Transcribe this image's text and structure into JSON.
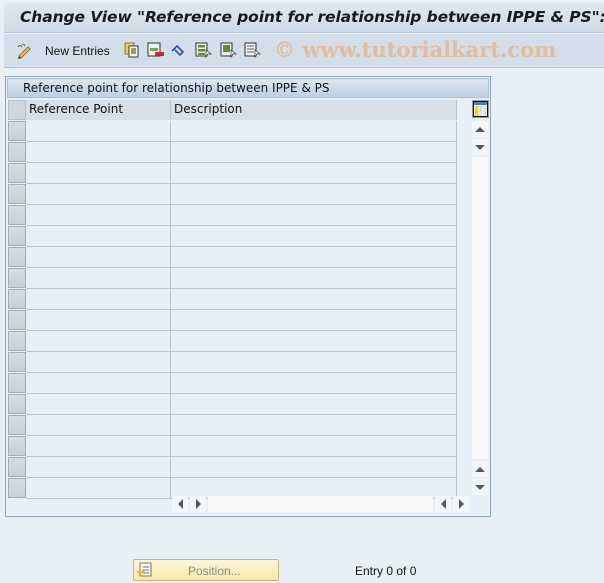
{
  "window": {
    "title": "Change View \"Reference point for relationship between IPPE & PS\": Overview"
  },
  "toolbar": {
    "new_entries_label": "New Entries",
    "icons": [
      "edit-pencil-icon",
      "copy-icon",
      "delete-icon",
      "undo-icon",
      "select-all-icon",
      "select-block-icon",
      "deselect-all-icon"
    ],
    "watermark": "© www.tutorialkart.com"
  },
  "table": {
    "title": "Reference point for relationship between IPPE & PS",
    "columns": [
      {
        "label": "Reference Point"
      },
      {
        "label": "Description"
      }
    ],
    "rows": [
      {
        "reference_point": "",
        "description": ""
      },
      {
        "reference_point": "",
        "description": ""
      },
      {
        "reference_point": "",
        "description": ""
      },
      {
        "reference_point": "",
        "description": ""
      },
      {
        "reference_point": "",
        "description": ""
      },
      {
        "reference_point": "",
        "description": ""
      },
      {
        "reference_point": "",
        "description": ""
      },
      {
        "reference_point": "",
        "description": ""
      },
      {
        "reference_point": "",
        "description": ""
      },
      {
        "reference_point": "",
        "description": ""
      },
      {
        "reference_point": "",
        "description": ""
      },
      {
        "reference_point": "",
        "description": ""
      },
      {
        "reference_point": "",
        "description": ""
      },
      {
        "reference_point": "",
        "description": ""
      },
      {
        "reference_point": "",
        "description": ""
      },
      {
        "reference_point": "",
        "description": ""
      },
      {
        "reference_point": "",
        "description": ""
      },
      {
        "reference_point": "",
        "description": ""
      }
    ]
  },
  "footer": {
    "position_button_label": "Position...",
    "entry_text": "Entry 0 of 0"
  },
  "colors": {
    "background": "#e9eff6",
    "toolbar": "#d2dee9",
    "position_button": "#f7e8a8"
  }
}
